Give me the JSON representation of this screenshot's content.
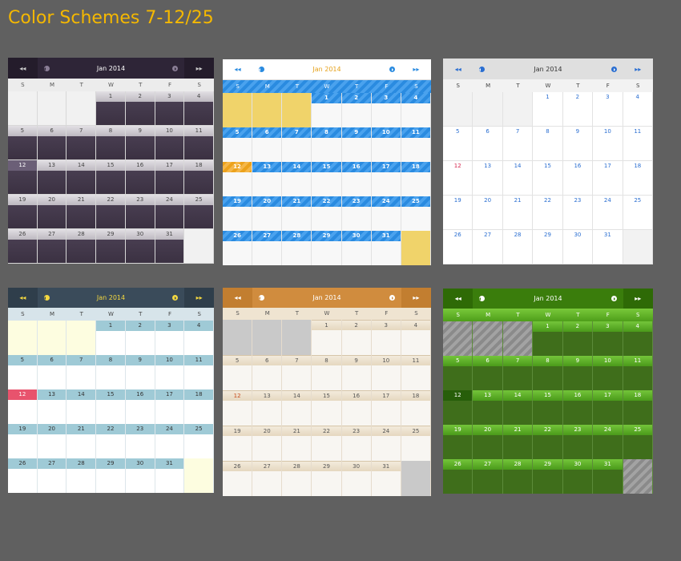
{
  "page": {
    "title": "Color Schemes 7-12/25"
  },
  "calendar": {
    "month_label": "Jan  2014",
    "prev_year": "◂◂",
    "next_year": "▸▸",
    "weekdays": [
      "S",
      "M",
      "T",
      "W",
      "T",
      "F",
      "S"
    ],
    "days": [
      [
        "",
        "",
        "",
        "1",
        "2",
        "3",
        "4"
      ],
      [
        "5",
        "6",
        "7",
        "8",
        "9",
        "10",
        "11"
      ],
      [
        "12",
        "13",
        "14",
        "15",
        "16",
        "17",
        "18"
      ],
      [
        "19",
        "20",
        "21",
        "22",
        "23",
        "24",
        "25"
      ],
      [
        "26",
        "27",
        "28",
        "29",
        "30",
        "31",
        ""
      ]
    ],
    "today": "12"
  },
  "schemes": [
    {
      "id": "t1",
      "name": "scheme-dark-purple"
    },
    {
      "id": "t2",
      "name": "scheme-blue-stripes"
    },
    {
      "id": "t3",
      "name": "scheme-light-grey"
    },
    {
      "id": "t4",
      "name": "scheme-slate-teal"
    },
    {
      "id": "t5",
      "name": "scheme-orange-beige"
    },
    {
      "id": "t6",
      "name": "scheme-green"
    }
  ]
}
